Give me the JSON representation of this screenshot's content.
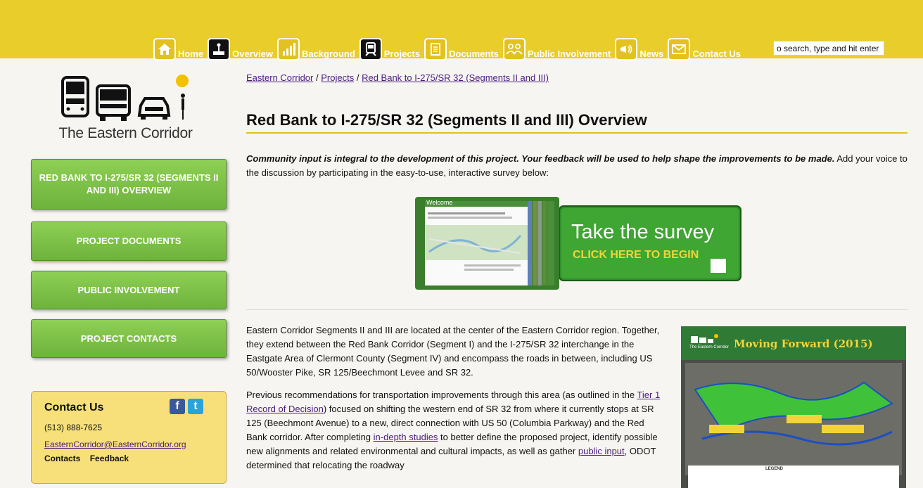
{
  "header": {
    "nav": [
      {
        "label": "Home",
        "icon": "home-icon"
      },
      {
        "label": "Overview",
        "icon": "overview-icon"
      },
      {
        "label": "Background",
        "icon": "bar-chart-icon"
      },
      {
        "label": "Projects",
        "icon": "train-icon"
      },
      {
        "label": "Documents",
        "icon": "document-icon"
      },
      {
        "label": "Public Involvement",
        "icon": "people-icon"
      },
      {
        "label": "News",
        "icon": "megaphone-icon"
      },
      {
        "label": "Contact Us",
        "icon": "envelope-icon"
      }
    ],
    "search_value": "o search, type and hit enter"
  },
  "logo": {
    "text": "The Eastern Corridor"
  },
  "sidebar": {
    "buttons": [
      {
        "label": "RED BANK TO I-275/SR 32 (SEGMENTS II AND III) OVERVIEW"
      },
      {
        "label": "PROJECT DOCUMENTS"
      },
      {
        "label": "PUBLIC INVOLVEMENT"
      },
      {
        "label": "PROJECT CONTACTS"
      }
    ],
    "contact": {
      "title": "Contact Us",
      "phone": "(513) 888-7625",
      "email": "EasternCorridor@EasternCorridor.org",
      "links": [
        "Contacts",
        "Feedback"
      ]
    }
  },
  "breadcrumb": [
    "Eastern Corridor",
    "/",
    "Projects",
    "/",
    "Red Bank to I-275/SR 32 (Segments II and III)"
  ],
  "page": {
    "title": "Red Bank to I-275/SR 32 (Segments II and III) Overview",
    "intro_bold": "Community input is integral to the development of this project. Your feedback will be used to help shape the improvements to be made.",
    "intro_rest": " Add your voice to the discussion by participating in the easy-to-use, interactive survey below:",
    "survey": {
      "heading": "Take the survey",
      "sub": "CLICK HERE TO BEGIN",
      "tab_label": "Welcome"
    },
    "para1": "Eastern Corridor Segments II and III are located at the center of the Eastern Corridor region. Together, they extend between the Red Bank Corridor (Segment I) and the I-275/SR 32 interchange in the Eastgate Area of Clermont County (Segment IV) and encompass the roads in between, including US 50/Wooster Pike, SR 125/Beechmont Levee and SR 32.",
    "para2_a": "Previous recommendations for transportation improvements through this area (as outlined in the ",
    "para2_link1": "Tier 1 Record of Decision",
    "para2_b": ") focused on shifting the western end of SR 32 from where it currently stops at SR 125 (Beechmont Avenue) to a new, direct connection with US 50 (Columbia Parkway) and the Red Bank corridor. After completing ",
    "para2_link2": "in-depth studies",
    "para2_c": " to better define the proposed project, identify possible new alignments and related environmental and cultural impacts, as well as gather ",
    "para2_link3": "public input",
    "para2_d": ", ODOT determined that relocating the roadway",
    "map_title": "Moving Forward (2015)",
    "map_logo": "The Eastern Corridor",
    "map_legend": "LEGEND"
  }
}
